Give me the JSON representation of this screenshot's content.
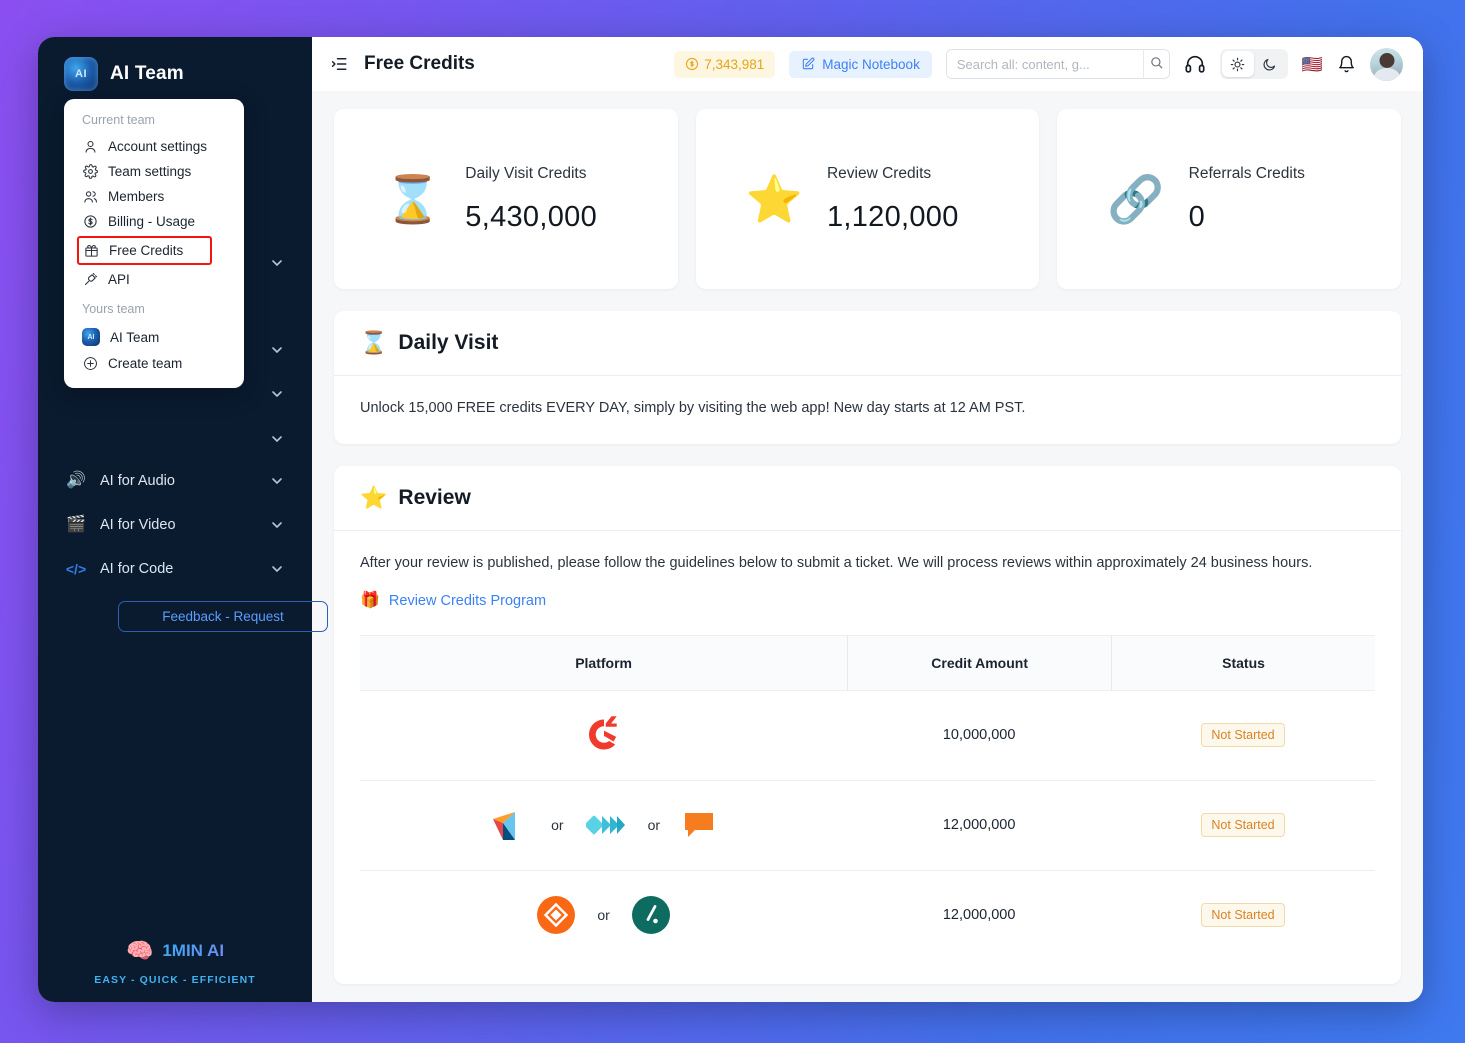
{
  "background": {
    "gradient_from": "#8b4ff0",
    "gradient_to": "#3f79f0"
  },
  "sidebar": {
    "brand": {
      "name": "AI Team",
      "logo_text": "AI",
      "logo_icon": "ai-team-logo"
    },
    "hidden_items_chevrons": 4,
    "items": [
      {
        "label": "AI for Audio",
        "icon": "speaker-icon",
        "emoji": "🔊",
        "chevron": true
      },
      {
        "label": "AI for Video",
        "icon": "clapperboard-icon",
        "emoji": "🎬",
        "chevron": true
      },
      {
        "label": "AI for Code",
        "icon": "code-icon",
        "emoji": "</>",
        "chevron": true
      }
    ],
    "feedback_button": "Feedback - Request",
    "footer": {
      "brand": "1MIN AI",
      "brain_icon": "brain-icon",
      "brain_emoji": "🧠",
      "tagline": "EASY - QUICK - EFFICIENT"
    }
  },
  "dropdown": {
    "current_team_header": "Current team",
    "items": [
      {
        "label": "Account settings",
        "icon": "user-icon"
      },
      {
        "label": "Team settings",
        "icon": "gear-icon"
      },
      {
        "label": "Members",
        "icon": "users-icon"
      },
      {
        "label": "Billing - Usage",
        "icon": "dollar-circle-icon"
      },
      {
        "label": "Free Credits",
        "icon": "gift-icon",
        "highlighted": true
      },
      {
        "label": "API",
        "icon": "plug-icon"
      }
    ],
    "yours_team_header": "Yours team",
    "teams": [
      {
        "label": "AI Team",
        "icon": "ai-team-logo"
      },
      {
        "label": "Create team",
        "icon": "plus-circle-icon"
      }
    ],
    "highlight_color": "#f5150f"
  },
  "topbar": {
    "menu_icon": "list-collapse-icon",
    "title": "Free Credits",
    "credits": {
      "value": "7,343,981",
      "icon": "coin-icon",
      "bg": "#fdf6e0",
      "color": "#e8a31a"
    },
    "magic_notebook": {
      "label": "Magic Notebook",
      "icon": "notebook-edit-icon",
      "bg": "#e8f1fe",
      "color": "#3b82f6"
    },
    "search": {
      "placeholder": "Search all: content, g...",
      "value": "",
      "icon": "search-icon"
    },
    "support_icon": "headphones-icon",
    "theme": {
      "light_icon": "sun-icon",
      "dark_icon": "moon-icon",
      "active": "light"
    },
    "language_flag": "us-flag-icon",
    "language_flag_emoji": "🇺🇸",
    "notifications_icon": "bell-icon",
    "avatar": "user-avatar"
  },
  "stat_cards": [
    {
      "label": "Daily Visit Credits",
      "value": "5,430,000",
      "icon": "hourglass-icon",
      "emoji": "⌛"
    },
    {
      "label": "Review Credits",
      "value": "1,120,000",
      "icon": "star-icon",
      "emoji": "⭐"
    },
    {
      "label": "Referrals Credits",
      "value": "0",
      "icon": "chain-link-icon",
      "emoji": "🔗"
    }
  ],
  "daily_visit": {
    "title": "Daily Visit",
    "icon": "hourglass-icon",
    "emoji": "⌛",
    "description": "Unlock 15,000 FREE credits EVERY DAY, simply by visiting the web app! New day starts at 12 AM PST."
  },
  "review": {
    "title": "Review",
    "icon": "star-icon",
    "emoji": "⭐",
    "description": "After your review is published, please follow the guidelines below to submit a ticket. We will process reviews within approximately 24 business hours.",
    "link": {
      "label": "Review Credits Program",
      "icon": "gift-icon",
      "emoji": "🎁"
    },
    "table": {
      "columns": [
        "Platform",
        "Credit Amount",
        "Status"
      ],
      "or_label": "or",
      "rows": [
        {
          "platforms": [
            {
              "name": "g2-logo",
              "color": "#ef3a2d"
            }
          ],
          "credit_amount": "10,000,000",
          "status": "Not Started"
        },
        {
          "platforms": [
            {
              "name": "capterra-logo",
              "color": "#ff9d28"
            },
            {
              "name": "getapp-logo",
              "color": "#4bd6e8"
            },
            {
              "name": "software-advice-logo",
              "color": "#f57c1f"
            }
          ],
          "credit_amount": "12,000,000",
          "status": "Not Started"
        },
        {
          "platforms": [
            {
              "name": "trustradius-logo",
              "color": "#f96815"
            },
            {
              "name": "trustpilot-logo",
              "color": "#0d6b5f"
            }
          ],
          "credit_amount": "12,000,000",
          "status": "Not Started"
        }
      ]
    }
  },
  "status_badge_colors": {
    "border": "#f2d9a7",
    "bg": "#fdf8ec",
    "text": "#d98324"
  }
}
